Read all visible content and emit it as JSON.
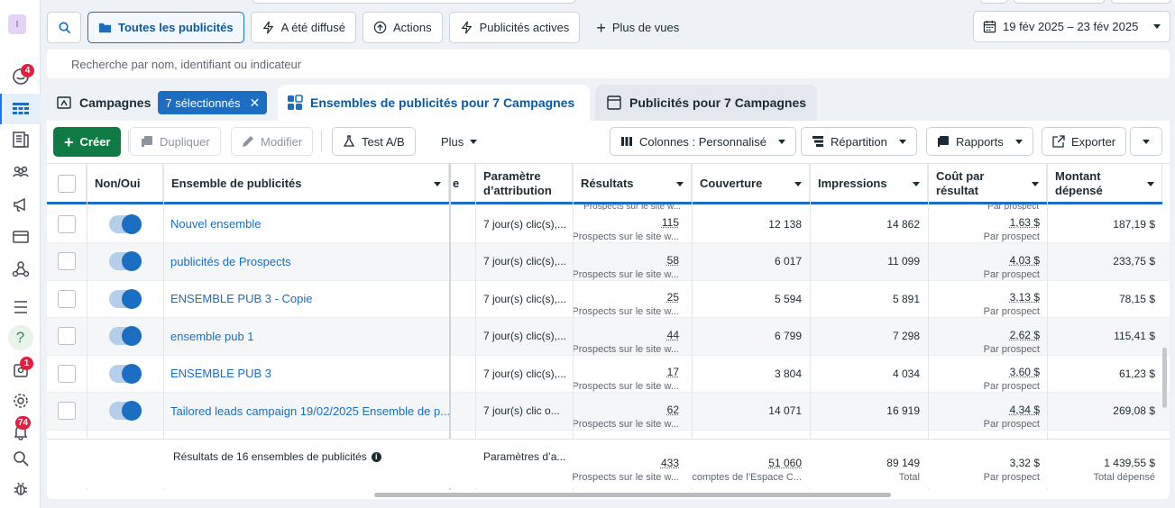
{
  "rail": {
    "avatar_letter": "I",
    "notifications_badge": "4",
    "messages_badge": "1",
    "alerts_badge": "74",
    "help_label": "?"
  },
  "toolbar": {
    "all_ads": "Toutes les publicités",
    "delivered": "A été diffusé",
    "actions": "Actions",
    "active_ads": "Publicités actives",
    "more_views": "Plus de vues",
    "date_range": "19 fév 2025 – 23 fév 2025"
  },
  "search": {
    "placeholder": "Recherche par nom, identifiant ou indicateur"
  },
  "tabs": {
    "campaigns": "Campagnes",
    "selected_chip": "7 sélectionnés",
    "adsets": "Ensembles de publicités pour 7 Campagnes",
    "ads": "Publicités pour 7 Campagnes"
  },
  "actions": {
    "create": "Créer",
    "duplicate": "Dupliquer",
    "edit": "Modifier",
    "abtest": "Test A/B",
    "more": "Plus",
    "columns": "Colonnes : Personnalisé",
    "breakdown": "Répartition",
    "reports": "Rapports",
    "export": "Exporter"
  },
  "columns": {
    "onoff": "Non/Oui",
    "adset": "Ensemble de publicités",
    "hidden_e": "e",
    "attribution_1": "Paramètre",
    "attribution_2": "d’attribution",
    "results": "Résultats",
    "reach": "Couverture",
    "impressions": "Impressions",
    "cpr_1": "Coût par",
    "cpr_2": "résultat",
    "spend_1": "Montant",
    "spend_2": "dépensé"
  },
  "peek": {
    "results_sub": "Prospects sur le site w...",
    "cpr_sub": "Par prospect"
  },
  "rows": [
    {
      "name": "Nouvel ensemble",
      "attribution": "7 jour(s) clic(s),...",
      "results": "115",
      "results_sub": "Prospects sur le site w...",
      "reach": "12 138",
      "impressions": "14 862",
      "cpr": "1,63 $",
      "cpr_sub": "Par prospect",
      "spend": "187,19 $"
    },
    {
      "name": "publicités de Prospects",
      "attribution": "7 jour(s) clic(s),...",
      "results": "58",
      "results_sub": "Prospects sur le site w...",
      "reach": "6 017",
      "impressions": "11 099",
      "cpr": "4,03 $",
      "cpr_sub": "Par prospect",
      "spend": "233,75 $"
    },
    {
      "name": "ENSEMBLE PUB 3 - Copie",
      "attribution": "7 jour(s) clic(s),...",
      "results": "25",
      "results_sub": "Prospects sur le site w...",
      "reach": "5 594",
      "impressions": "5 891",
      "cpr": "3,13 $",
      "cpr_sub": "Par prospect",
      "spend": "78,15 $"
    },
    {
      "name": "ensemble pub 1",
      "attribution": "7 jour(s) clic(s),...",
      "results": "44",
      "results_sub": "Prospects sur le site w...",
      "reach": "6 799",
      "impressions": "7 298",
      "cpr": "2,62 $",
      "cpr_sub": "Par prospect",
      "spend": "115,41 $"
    },
    {
      "name": "ENSEMBLE PUB 3",
      "attribution": "7 jour(s) clic(s),...",
      "results": "17",
      "results_sub": "Prospects sur le site w...",
      "reach": "3 804",
      "impressions": "4 034",
      "cpr": "3,60 $",
      "cpr_sub": "Par prospect",
      "spend": "61,23 $"
    },
    {
      "name": "Tailored leads campaign 19/02/2025 Ensemble de p...",
      "attribution": "7 jour(s) clic o...",
      "results": "62",
      "results_sub": "Prospects sur le site w...",
      "reach": "14 071",
      "impressions": "16 919",
      "cpr": "4,34 $",
      "cpr_sub": "Par prospect",
      "spend": "269,08 $"
    }
  ],
  "totals": {
    "label": "Résultats de 16 ensembles de publicités",
    "info_icon": "i",
    "attribution": "Paramètres d’a...",
    "results": "433",
    "results_sub": "Prospects sur le site w...",
    "reach": "51 060",
    "reach_sub": "comptes de l’Espace C...",
    "impressions": "89 149",
    "impressions_sub": "Total",
    "cpr": "3,32 $",
    "cpr_sub": "Par prospect",
    "spend": "1 439,55 $",
    "spend_sub": "Total dépensé"
  },
  "colors": {
    "accent": "#1b6ec2",
    "create_green": "#0f7a43",
    "badge_red": "#e41e3f"
  }
}
